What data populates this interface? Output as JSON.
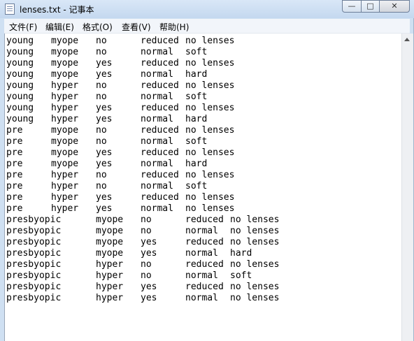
{
  "window": {
    "title": "lenses.txt - 记事本"
  },
  "window_buttons": {
    "minimize": "—",
    "maximize": "□",
    "close": "✕"
  },
  "menu": [
    "文件(F)",
    "编辑(E)",
    "格式(O)",
    "查看(V)",
    "帮助(H)"
  ],
  "rows": [
    [
      "young",
      "myope",
      "no",
      "reduced",
      "no lenses"
    ],
    [
      "young",
      "myope",
      "no",
      "normal",
      "soft"
    ],
    [
      "young",
      "myope",
      "yes",
      "reduced",
      "no lenses"
    ],
    [
      "young",
      "myope",
      "yes",
      "normal",
      "hard"
    ],
    [
      "young",
      "hyper",
      "no",
      "reduced",
      "no lenses"
    ],
    [
      "young",
      "hyper",
      "no",
      "normal",
      "soft"
    ],
    [
      "young",
      "hyper",
      "yes",
      "reduced",
      "no lenses"
    ],
    [
      "young",
      "hyper",
      "yes",
      "normal",
      "hard"
    ],
    [
      "pre",
      "myope",
      "no",
      "reduced",
      "no lenses"
    ],
    [
      "pre",
      "myope",
      "no",
      "normal",
      "soft"
    ],
    [
      "pre",
      "myope",
      "yes",
      "reduced",
      "no lenses"
    ],
    [
      "pre",
      "myope",
      "yes",
      "normal",
      "hard"
    ],
    [
      "pre",
      "hyper",
      "no",
      "reduced",
      "no lenses"
    ],
    [
      "pre",
      "hyper",
      "no",
      "normal",
      "soft"
    ],
    [
      "pre",
      "hyper",
      "yes",
      "reduced",
      "no lenses"
    ],
    [
      "pre",
      "hyper",
      "yes",
      "normal",
      "no lenses"
    ],
    [
      "presbyopic",
      "myope",
      "no",
      "reduced",
      "no lenses"
    ],
    [
      "presbyopic",
      "myope",
      "no",
      "normal",
      "no lenses"
    ],
    [
      "presbyopic",
      "myope",
      "yes",
      "reduced",
      "no lenses"
    ],
    [
      "presbyopic",
      "myope",
      "yes",
      "normal",
      "hard"
    ],
    [
      "presbyopic",
      "hyper",
      "no",
      "reduced",
      "no lenses"
    ],
    [
      "presbyopic",
      "hyper",
      "no",
      "normal",
      "soft"
    ],
    [
      "presbyopic",
      "hyper",
      "yes",
      "reduced",
      "no lenses"
    ],
    [
      "presbyopic",
      "hyper",
      "yes",
      "normal",
      "no lenses"
    ]
  ]
}
